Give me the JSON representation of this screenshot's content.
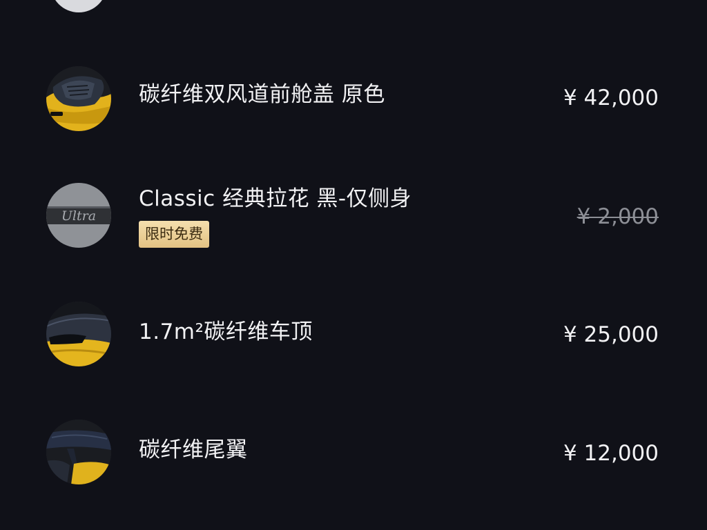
{
  "colors": {
    "background": "#101118",
    "text": "#f2f2f4",
    "struck_price": "#8d8f96",
    "badge_bg": "#ecd29a",
    "badge_text": "#3a2a10"
  },
  "items": [
    {
      "title": "碳纤维双风道前舱盖 原色",
      "price": "¥ 42,000",
      "thumbnail_icon": "carbon-hood-thumbnail"
    },
    {
      "title": "Classic 经典拉花 黑-仅侧身",
      "badge": "限时免费",
      "price": "¥ 2,000",
      "price_struck": true,
      "thumbnail_icon": "ultra-decal-thumbnail",
      "thumbnail_text": "Ultra"
    },
    {
      "title": "1.7m²碳纤维车顶",
      "price": "¥ 25,000",
      "thumbnail_icon": "carbon-roof-thumbnail"
    },
    {
      "title": "碳纤维尾翼",
      "price": "¥ 12,000",
      "thumbnail_icon": "carbon-wing-thumbnail"
    }
  ]
}
